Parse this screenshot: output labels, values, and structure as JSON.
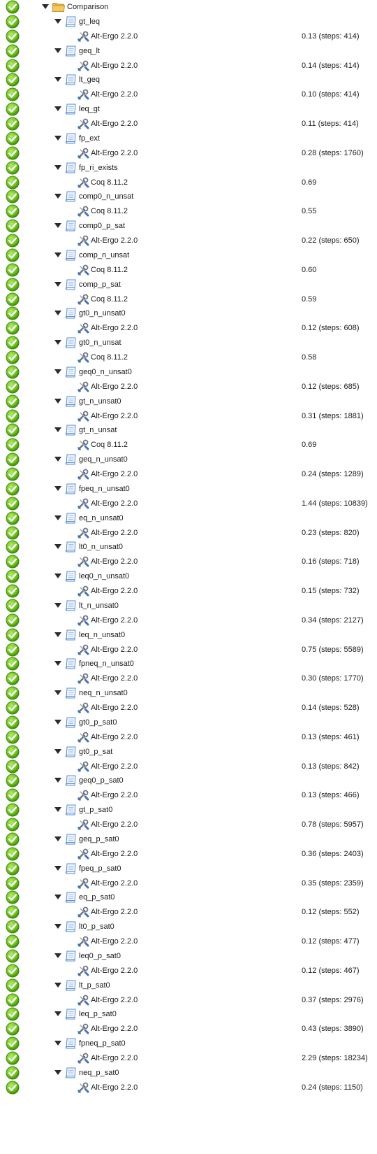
{
  "tree": {
    "root": {
      "label": "Comparison",
      "status": "proved",
      "expanded": true,
      "icon": "folder-icon"
    },
    "goals": [
      {
        "name": "gt_leq",
        "prover": "Alt-Ergo 2.2.0",
        "time": "0.13 (steps: 414)"
      },
      {
        "name": "geq_lt",
        "prover": "Alt-Ergo 2.2.0",
        "time": "0.14 (steps: 414)"
      },
      {
        "name": "lt_geq",
        "prover": "Alt-Ergo 2.2.0",
        "time": "0.10 (steps: 414)"
      },
      {
        "name": "leq_gt",
        "prover": "Alt-Ergo 2.2.0",
        "time": "0.11 (steps: 414)"
      },
      {
        "name": "fp_ext",
        "prover": "Alt-Ergo 2.2.0",
        "time": "0.28 (steps: 1760)"
      },
      {
        "name": "fp_ri_exists",
        "prover": "Coq 8.11.2",
        "time": "0.69"
      },
      {
        "name": "comp0_n_unsat",
        "prover": "Coq 8.11.2",
        "time": "0.55"
      },
      {
        "name": "comp0_p_sat",
        "prover": "Alt-Ergo 2.2.0",
        "time": "0.22 (steps: 650)"
      },
      {
        "name": "comp_n_unsat",
        "prover": "Coq 8.11.2",
        "time": "0.60"
      },
      {
        "name": "comp_p_sat",
        "prover": "Coq 8.11.2",
        "time": "0.59"
      },
      {
        "name": "gt0_n_unsat0",
        "prover": "Alt-Ergo 2.2.0",
        "time": "0.12 (steps: 608)"
      },
      {
        "name": "gt0_n_unsat",
        "prover": "Coq 8.11.2",
        "time": "0.58"
      },
      {
        "name": "geq0_n_unsat0",
        "prover": "Alt-Ergo 2.2.0",
        "time": "0.12 (steps: 685)"
      },
      {
        "name": "gt_n_unsat0",
        "prover": "Alt-Ergo 2.2.0",
        "time": "0.31 (steps: 1881)"
      },
      {
        "name": "gt_n_unsat",
        "prover": "Coq 8.11.2",
        "time": "0.69"
      },
      {
        "name": "geq_n_unsat0",
        "prover": "Alt-Ergo 2.2.0",
        "time": "0.24 (steps: 1289)"
      },
      {
        "name": "fpeq_n_unsat0",
        "prover": "Alt-Ergo 2.2.0",
        "time": "1.44 (steps: 10839)"
      },
      {
        "name": "eq_n_unsat0",
        "prover": "Alt-Ergo 2.2.0",
        "time": "0.23 (steps: 820)"
      },
      {
        "name": "lt0_n_unsat0",
        "prover": "Alt-Ergo 2.2.0",
        "time": "0.16 (steps: 718)"
      },
      {
        "name": "leq0_n_unsat0",
        "prover": "Alt-Ergo 2.2.0",
        "time": "0.15 (steps: 732)"
      },
      {
        "name": "lt_n_unsat0",
        "prover": "Alt-Ergo 2.2.0",
        "time": "0.34 (steps: 2127)"
      },
      {
        "name": "leq_n_unsat0",
        "prover": "Alt-Ergo 2.2.0",
        "time": "0.75 (steps: 5589)"
      },
      {
        "name": "fpneq_n_unsat0",
        "prover": "Alt-Ergo 2.2.0",
        "time": "0.30 (steps: 1770)"
      },
      {
        "name": "neq_n_unsat0",
        "prover": "Alt-Ergo 2.2.0",
        "time": "0.14 (steps: 528)"
      },
      {
        "name": "gt0_p_sat0",
        "prover": "Alt-Ergo 2.2.0",
        "time": "0.13 (steps: 461)"
      },
      {
        "name": "gt0_p_sat",
        "prover": "Alt-Ergo 2.2.0",
        "time": "0.13 (steps: 842)"
      },
      {
        "name": "geq0_p_sat0",
        "prover": "Alt-Ergo 2.2.0",
        "time": "0.13 (steps: 466)"
      },
      {
        "name": "gt_p_sat0",
        "prover": "Alt-Ergo 2.2.0",
        "time": "0.78 (steps: 5957)"
      },
      {
        "name": "geq_p_sat0",
        "prover": "Alt-Ergo 2.2.0",
        "time": "0.36 (steps: 2403)"
      },
      {
        "name": "fpeq_p_sat0",
        "prover": "Alt-Ergo 2.2.0",
        "time": "0.35 (steps: 2359)"
      },
      {
        "name": "eq_p_sat0",
        "prover": "Alt-Ergo 2.2.0",
        "time": "0.12 (steps: 552)"
      },
      {
        "name": "lt0_p_sat0",
        "prover": "Alt-Ergo 2.2.0",
        "time": "0.12 (steps: 477)"
      },
      {
        "name": "leq0_p_sat0",
        "prover": "Alt-Ergo 2.2.0",
        "time": "0.12 (steps: 467)"
      },
      {
        "name": "lt_p_sat0",
        "prover": "Alt-Ergo 2.2.0",
        "time": "0.37 (steps: 2976)"
      },
      {
        "name": "leq_p_sat0",
        "prover": "Alt-Ergo 2.2.0",
        "time": "0.43 (steps: 3890)"
      },
      {
        "name": "fpneq_p_sat0",
        "prover": "Alt-Ergo 2.2.0",
        "time": "2.29 (steps: 18234)"
      },
      {
        "name": "neq_p_sat0",
        "prover": "Alt-Ergo 2.2.0",
        "time": "0.24 (steps: 1150)"
      }
    ]
  },
  "icons": {
    "status": "check-circle-icon",
    "expander": "triangle-down-icon",
    "folder": "folder-icon",
    "goal": "document-scroll-icon",
    "prover": "tools-icon"
  },
  "colors": {
    "status_green": "#6cbf1e",
    "status_green_dark": "#3e8a0b",
    "folder": "#f2c862",
    "goal_icon": "#5b8fd3"
  }
}
